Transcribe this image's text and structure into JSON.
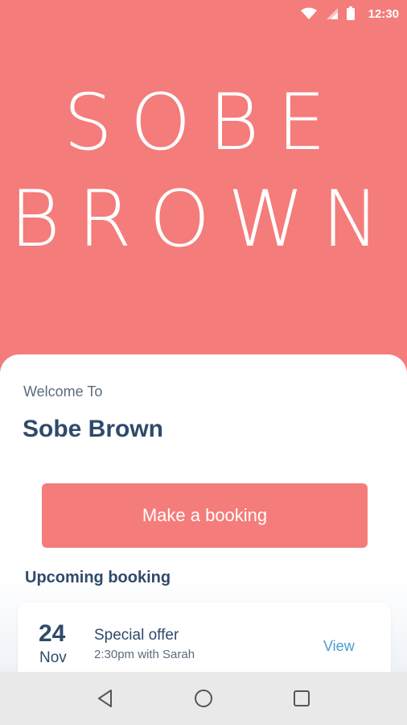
{
  "status_bar": {
    "time": "12:30",
    "icons": [
      "wifi-icon",
      "signal-icon",
      "battery-icon"
    ]
  },
  "brand": {
    "line1": "SOBE",
    "line2": "BROWN"
  },
  "main": {
    "welcome_label": "Welcome To",
    "salon_name": "Sobe Brown",
    "booking_button_label": "Make a booking",
    "upcoming_title": "Upcoming booking",
    "upcoming": {
      "day": "24",
      "month": "Nov",
      "title": "Special offer",
      "detail": "2:30pm with Sarah",
      "action_label": "View"
    }
  },
  "nav": {
    "icons": [
      "back-icon",
      "home-icon",
      "recents-icon"
    ]
  },
  "colors": {
    "accent": "#f47c7a",
    "text_dark": "#2f4a6b",
    "link": "#4a9ad4"
  }
}
